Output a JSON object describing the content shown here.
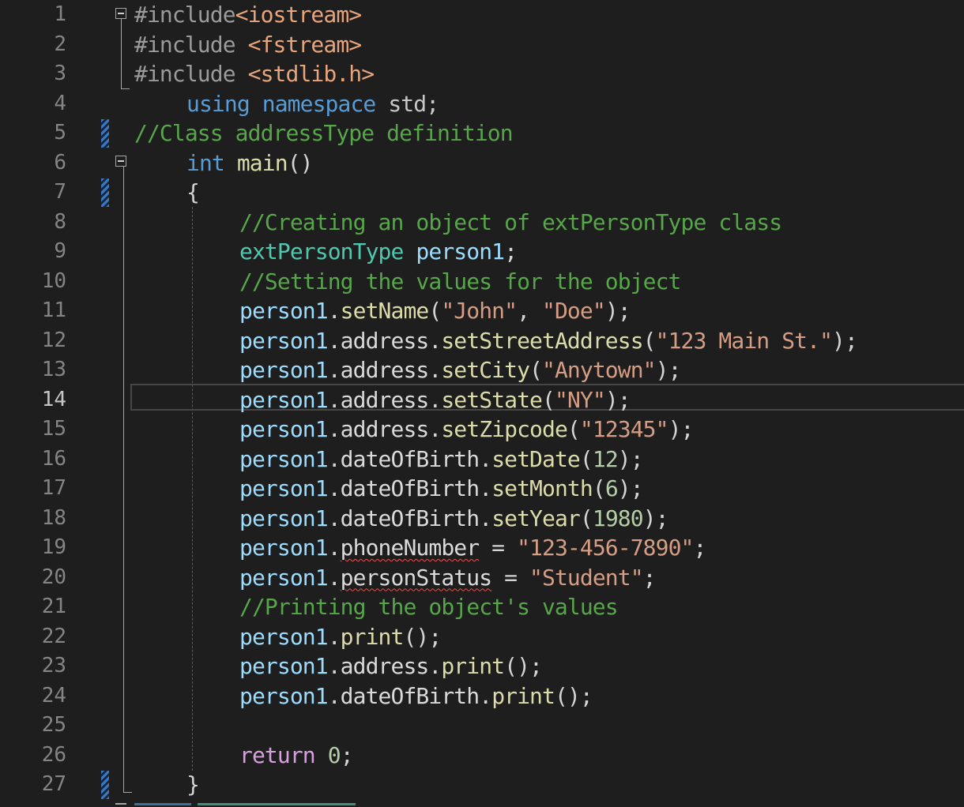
{
  "editor": {
    "language": "C++",
    "active_line": 14,
    "lines": [
      {
        "n": "1",
        "indent": 0,
        "fold": "start",
        "tokens": [
          {
            "t": "#include",
            "c": "pp"
          },
          {
            "t": "<iostream>",
            "c": "inc"
          }
        ]
      },
      {
        "n": "2",
        "indent": 0,
        "tokens": [
          {
            "t": "#include ",
            "c": "pp"
          },
          {
            "t": "<fstream>",
            "c": "inc"
          }
        ]
      },
      {
        "n": "3",
        "indent": 0,
        "tokens": [
          {
            "t": "#include ",
            "c": "pp"
          },
          {
            "t": "<stdlib.h>",
            "c": "inc"
          }
        ]
      },
      {
        "n": "4",
        "indent": 1,
        "tokens": [
          {
            "t": "using",
            "c": "kw"
          },
          {
            "t": " ",
            "c": "pl"
          },
          {
            "t": "namespace",
            "c": "kw"
          },
          {
            "t": " std;",
            "c": "ns"
          }
        ]
      },
      {
        "n": "5",
        "indent": 0,
        "change": true,
        "tokens": [
          {
            "t": "//Class addressType definition",
            "c": "cm"
          }
        ]
      },
      {
        "n": "6",
        "indent": 1,
        "fold": "start",
        "tokens": [
          {
            "t": "int",
            "c": "kw"
          },
          {
            "t": " ",
            "c": "pl"
          },
          {
            "t": "main",
            "c": "fn"
          },
          {
            "t": "()",
            "c": "pl"
          }
        ]
      },
      {
        "n": "7",
        "indent": 1,
        "change": true,
        "tokens": [
          {
            "t": "{",
            "c": "pl"
          }
        ]
      },
      {
        "n": "8",
        "indent": 2,
        "tokens": [
          {
            "t": "//Creating an object of extPersonType class",
            "c": "cm"
          }
        ]
      },
      {
        "n": "9",
        "indent": 2,
        "tokens": [
          {
            "t": "extPersonType",
            "c": "ty"
          },
          {
            "t": " ",
            "c": "pl"
          },
          {
            "t": "person1",
            "c": "var"
          },
          {
            "t": ";",
            "c": "pl"
          }
        ]
      },
      {
        "n": "10",
        "indent": 2,
        "tokens": [
          {
            "t": "//Setting the values for the object",
            "c": "cm"
          }
        ]
      },
      {
        "n": "11",
        "indent": 2,
        "tokens": [
          {
            "t": "person1",
            "c": "var"
          },
          {
            "t": ".",
            "c": "pl"
          },
          {
            "t": "setName",
            "c": "fn"
          },
          {
            "t": "(",
            "c": "pl"
          },
          {
            "t": "\"John\"",
            "c": "str"
          },
          {
            "t": ", ",
            "c": "pl"
          },
          {
            "t": "\"Doe\"",
            "c": "str"
          },
          {
            "t": ");",
            "c": "pl"
          }
        ]
      },
      {
        "n": "12",
        "indent": 2,
        "tokens": [
          {
            "t": "person1",
            "c": "var"
          },
          {
            "t": ".",
            "c": "pl"
          },
          {
            "t": "address",
            "c": "mem"
          },
          {
            "t": ".",
            "c": "pl"
          },
          {
            "t": "setStreetAddress",
            "c": "fn"
          },
          {
            "t": "(",
            "c": "pl"
          },
          {
            "t": "\"123 Main St.\"",
            "c": "str"
          },
          {
            "t": ");",
            "c": "pl"
          }
        ]
      },
      {
        "n": "13",
        "indent": 2,
        "tokens": [
          {
            "t": "person1",
            "c": "var"
          },
          {
            "t": ".",
            "c": "pl"
          },
          {
            "t": "address",
            "c": "mem"
          },
          {
            "t": ".",
            "c": "pl"
          },
          {
            "t": "setCity",
            "c": "fn"
          },
          {
            "t": "(",
            "c": "pl"
          },
          {
            "t": "\"Anytown\"",
            "c": "str"
          },
          {
            "t": ");",
            "c": "pl"
          }
        ]
      },
      {
        "n": "14",
        "indent": 2,
        "tokens": [
          {
            "t": "person1",
            "c": "var"
          },
          {
            "t": ".",
            "c": "pl"
          },
          {
            "t": "address",
            "c": "mem"
          },
          {
            "t": ".",
            "c": "pl"
          },
          {
            "t": "setState",
            "c": "fn"
          },
          {
            "t": "(",
            "c": "pl"
          },
          {
            "t": "\"NY\"",
            "c": "str"
          },
          {
            "t": ");",
            "c": "pl"
          }
        ]
      },
      {
        "n": "15",
        "indent": 2,
        "tokens": [
          {
            "t": "person1",
            "c": "var"
          },
          {
            "t": ".",
            "c": "pl"
          },
          {
            "t": "address",
            "c": "mem"
          },
          {
            "t": ".",
            "c": "pl"
          },
          {
            "t": "setZipcode",
            "c": "fn"
          },
          {
            "t": "(",
            "c": "pl"
          },
          {
            "t": "\"12345\"",
            "c": "str"
          },
          {
            "t": ");",
            "c": "pl"
          }
        ]
      },
      {
        "n": "16",
        "indent": 2,
        "tokens": [
          {
            "t": "person1",
            "c": "var"
          },
          {
            "t": ".",
            "c": "pl"
          },
          {
            "t": "dateOfBirth",
            "c": "mem"
          },
          {
            "t": ".",
            "c": "pl"
          },
          {
            "t": "setDate",
            "c": "fn"
          },
          {
            "t": "(",
            "c": "pl"
          },
          {
            "t": "12",
            "c": "num"
          },
          {
            "t": ");",
            "c": "pl"
          }
        ]
      },
      {
        "n": "17",
        "indent": 2,
        "tokens": [
          {
            "t": "person1",
            "c": "var"
          },
          {
            "t": ".",
            "c": "pl"
          },
          {
            "t": "dateOfBirth",
            "c": "mem"
          },
          {
            "t": ".",
            "c": "pl"
          },
          {
            "t": "setMonth",
            "c": "fn"
          },
          {
            "t": "(",
            "c": "pl"
          },
          {
            "t": "6",
            "c": "num"
          },
          {
            "t": ");",
            "c": "pl"
          }
        ]
      },
      {
        "n": "18",
        "indent": 2,
        "tokens": [
          {
            "t": "person1",
            "c": "var"
          },
          {
            "t": ".",
            "c": "pl"
          },
          {
            "t": "dateOfBirth",
            "c": "mem"
          },
          {
            "t": ".",
            "c": "pl"
          },
          {
            "t": "setYear",
            "c": "fn"
          },
          {
            "t": "(",
            "c": "pl"
          },
          {
            "t": "1980",
            "c": "num"
          },
          {
            "t": ");",
            "c": "pl"
          }
        ]
      },
      {
        "n": "19",
        "indent": 2,
        "tokens": [
          {
            "t": "person1",
            "c": "var"
          },
          {
            "t": ".",
            "c": "pl"
          },
          {
            "t": "phoneNumber",
            "c": "mem",
            "sq": true
          },
          {
            "t": " = ",
            "c": "pl"
          },
          {
            "t": "\"123-456-7890\"",
            "c": "str"
          },
          {
            "t": ";",
            "c": "pl"
          }
        ]
      },
      {
        "n": "20",
        "indent": 2,
        "tokens": [
          {
            "t": "person1",
            "c": "var"
          },
          {
            "t": ".",
            "c": "pl"
          },
          {
            "t": "personStatus",
            "c": "mem",
            "sq": true
          },
          {
            "t": " = ",
            "c": "pl"
          },
          {
            "t": "\"Student\"",
            "c": "str"
          },
          {
            "t": ";",
            "c": "pl"
          }
        ]
      },
      {
        "n": "21",
        "indent": 2,
        "tokens": [
          {
            "t": "//Printing the object's values",
            "c": "cm"
          }
        ]
      },
      {
        "n": "22",
        "indent": 2,
        "tokens": [
          {
            "t": "person1",
            "c": "var"
          },
          {
            "t": ".",
            "c": "pl"
          },
          {
            "t": "print",
            "c": "fn"
          },
          {
            "t": "();",
            "c": "pl"
          }
        ]
      },
      {
        "n": "23",
        "indent": 2,
        "tokens": [
          {
            "t": "person1",
            "c": "var"
          },
          {
            "t": ".",
            "c": "pl"
          },
          {
            "t": "address",
            "c": "mem"
          },
          {
            "t": ".",
            "c": "pl"
          },
          {
            "t": "print",
            "c": "fn"
          },
          {
            "t": "();",
            "c": "pl"
          }
        ]
      },
      {
        "n": "24",
        "indent": 2,
        "tokens": [
          {
            "t": "person1",
            "c": "var"
          },
          {
            "t": ".",
            "c": "pl"
          },
          {
            "t": "dateOfBirth",
            "c": "mem"
          },
          {
            "t": ".",
            "c": "pl"
          },
          {
            "t": "print",
            "c": "fn"
          },
          {
            "t": "();",
            "c": "pl"
          }
        ]
      },
      {
        "n": "25",
        "indent": 2,
        "tokens": []
      },
      {
        "n": "26",
        "indent": 2,
        "tokens": [
          {
            "t": "return",
            "c": "ctl"
          },
          {
            "t": " ",
            "c": "pl"
          },
          {
            "t": "0",
            "c": "num"
          },
          {
            "t": ";",
            "c": "pl"
          }
        ]
      },
      {
        "n": "27",
        "indent": 1,
        "change": true,
        "tokens": [
          {
            "t": "}",
            "c": "pl"
          }
        ]
      }
    ]
  }
}
